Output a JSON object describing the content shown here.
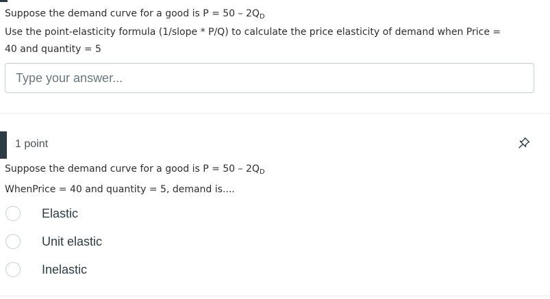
{
  "question1": {
    "text_line1_prefix": "Suppose the demand curve for a good is P = 50 – 2Q",
    "text_line1_sub": "D",
    "text_line2": "Use the point-elasticity formula (1/slope * P/Q) to calculate the price elasticity of demand when Price =",
    "text_line3": "40 and quantity = 5",
    "answer_placeholder": "Type your answer...",
    "answer_value": ""
  },
  "question2": {
    "points": "1 point",
    "text_line1_prefix": "Suppose the demand curve for a good is P = 50 – 2Q",
    "text_line1_sub": "D",
    "text_line2": "WhenPrice = 40 and quantity = 5, demand is....",
    "options": [
      {
        "label": "Elastic",
        "selected": false
      },
      {
        "label": "Unit elastic",
        "selected": false
      },
      {
        "label": "Inelastic",
        "selected": false
      }
    ]
  },
  "icons": {
    "pin": "pin-icon"
  },
  "colors": {
    "accent_bar": "#2d3b45",
    "border": "#c7cdd1",
    "text": "#2d2d2d"
  }
}
